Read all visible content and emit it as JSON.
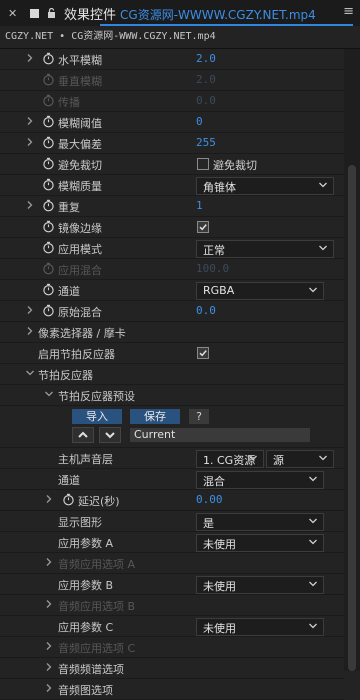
{
  "header": {
    "title": "效果控件",
    "subtitle": "CG资源网-WWWW.CGZY.NET.mp4"
  },
  "breadcrumb": "CGZY.NET • CG资源网-WWW.CGZY.NET.mp4",
  "rows": [
    {
      "label": "水平模糊",
      "value": "2.0",
      "type": "num"
    },
    {
      "label": "垂直模糊",
      "value": "2.0",
      "type": "num",
      "disabled": true
    },
    {
      "label": "传播",
      "value": "0.0",
      "type": "num",
      "disabled": true
    },
    {
      "label": "模糊阈值",
      "value": "0",
      "type": "num"
    },
    {
      "label": "最大偏差",
      "value": "255",
      "type": "num"
    },
    {
      "label": "避免裁切",
      "cb_label": "避免裁切",
      "type": "checkbox",
      "checked": false
    },
    {
      "label": "模糊质量",
      "value": "角锥体",
      "type": "dropdown"
    },
    {
      "label": "重复",
      "value": "1",
      "type": "num"
    },
    {
      "label": "镜像边缘",
      "type": "checkbox",
      "checked": true
    },
    {
      "label": "应用模式",
      "value": "正常",
      "type": "dropdown"
    },
    {
      "label": "应用混合",
      "value": "100.0",
      "type": "num",
      "disabled": true
    },
    {
      "label": "通道",
      "value": "RGBA",
      "type": "dropdown"
    },
    {
      "label": "原始混合",
      "value": "0.0",
      "type": "num"
    },
    {
      "label": "像素选择器 / 摩卡",
      "type": "group"
    },
    {
      "label": "启用节拍反应器",
      "type": "checkbox",
      "checked": true
    },
    {
      "label": "节拍反应器",
      "type": "group"
    },
    {
      "label": "节拍反应器预设",
      "type": "group"
    }
  ],
  "preset_bar": {
    "import_label": "导入",
    "save_label": "保存",
    "help_label": "?",
    "preset_name": "Current"
  },
  "rows2": [
    {
      "label": "主机声音层",
      "value": "1. CG资源",
      "value2": "源",
      "type": "dropdown2"
    },
    {
      "label": "通道",
      "value": "混合",
      "type": "dropdown"
    },
    {
      "label": "延迟(秒)",
      "value": "0.00",
      "type": "num"
    },
    {
      "label": "显示图形",
      "value": "是",
      "type": "dropdown"
    },
    {
      "label": "应用参数 A",
      "value": "未使用",
      "type": "dropdown"
    },
    {
      "label": "音频应用选项 A",
      "type": "group",
      "disabled": true
    },
    {
      "label": "应用参数 B",
      "value": "未使用",
      "type": "dropdown"
    },
    {
      "label": "音频应用选项 B",
      "type": "group",
      "disabled": true
    },
    {
      "label": "应用参数 C",
      "value": "未使用",
      "type": "dropdown"
    },
    {
      "label": "音频应用选项 C",
      "type": "group",
      "disabled": true
    },
    {
      "label": "音频频谱选项",
      "type": "group"
    },
    {
      "label": "音频图选项",
      "type": "group"
    }
  ],
  "colors": {
    "accent": "#2f86e0",
    "value_blue": "#3d8fe4",
    "background": "#232323"
  }
}
